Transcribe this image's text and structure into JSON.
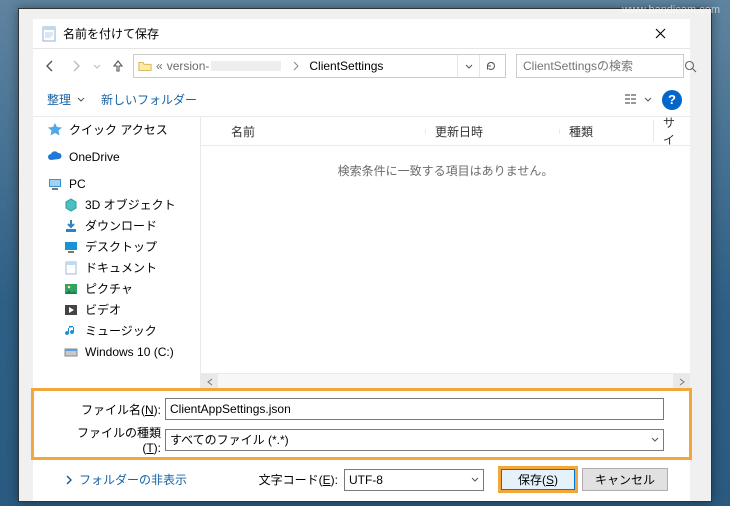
{
  "watermark": "www.bandicam.com",
  "title": "名前を付けて保存",
  "address": {
    "prefix": "«",
    "seg1": "version-",
    "seg2": "ClientSettings"
  },
  "search": {
    "placeholder": "ClientSettingsの検索"
  },
  "toolbar": {
    "organize": "整理",
    "newfolder": "新しいフォルダー"
  },
  "columns": {
    "name": "名前",
    "date": "更新日時",
    "type": "種類",
    "size": "サイ"
  },
  "empty_msg": "検索条件に一致する項目はありません。",
  "tree": {
    "quick": "クイック アクセス",
    "onedrive": "OneDrive",
    "pc": "PC",
    "obj3d": "3D オブジェクト",
    "downloads": "ダウンロード",
    "desktop": "デスクトップ",
    "documents": "ドキュメント",
    "pictures": "ピクチャ",
    "videos": "ビデオ",
    "music": "ミュージック",
    "drive": "Windows 10 (C:)"
  },
  "fields": {
    "filename_label_a": "ファイル名(",
    "filename_label_hot": "N",
    "filename_label_b": "):",
    "filename_value": "ClientAppSettings.json",
    "filetype_label_a": "ファイルの種類(",
    "filetype_label_hot": "T",
    "filetype_label_b": "):",
    "filetype_value": "すべてのファイル  (*.*)"
  },
  "bottom": {
    "hide_folders": "フォルダーの非表示",
    "encoding_label_a": "文字コード(",
    "encoding_label_hot": "E",
    "encoding_label_b": "):",
    "encoding_value": "UTF-8",
    "save_a": "保存(",
    "save_hot": "S",
    "save_b": ")",
    "cancel": "キャンセル"
  }
}
